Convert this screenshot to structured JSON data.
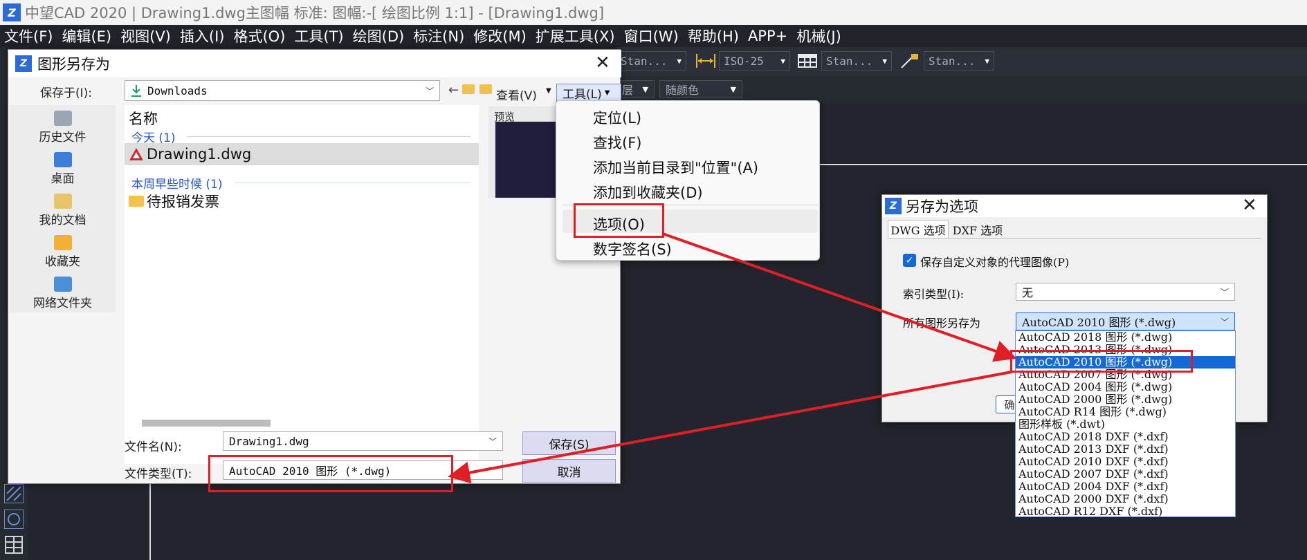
{
  "window": {
    "title": "中望CAD 2020 | Drawing1.dwg主图幅  标准: 图幅:-[ 绘图比例 1:1] - [Drawing1.dwg]",
    "logo": "Z"
  },
  "menubar": {
    "items": [
      "文件(F)",
      "编辑(E)",
      "视图(V)",
      "插入(I)",
      "格式(O)",
      "工具(T)",
      "绘图(D)",
      "标注(N)",
      "修改(M)",
      "扩展工具(X)",
      "窗口(W)",
      "帮助(H)",
      "APP+",
      "机械(J)"
    ]
  },
  "toolbar": {
    "text_style": "Stan...",
    "dim_style": "ISO-25",
    "table_style": "Stan...",
    "multileader_style": "Stan...",
    "layer": "层",
    "color": "随颜色"
  },
  "save_dialog": {
    "title": "图形另存为",
    "save_in_label": "保存于(I):",
    "save_in_value": "Downloads",
    "view_label": "查看(V)",
    "tools_label": "工具(L)",
    "places": [
      "历史文件",
      "桌面",
      "我的文档",
      "收藏夹",
      "网络文件夹"
    ],
    "column_name": "名称",
    "preview_label": "预览",
    "group_today": "今天 (1)",
    "file_drawing": "Drawing1.dwg",
    "group_earlier": "本周早些时候 (1)",
    "folder_invoice": "待报销发票",
    "filename_label": "文件名(N):",
    "filename_value": "Drawing1.dwg",
    "filetype_label": "文件类型(T):",
    "filetype_value": "AutoCAD 2010 图形 (*.dwg)",
    "save_button": "保存(S)",
    "cancel_button": "取消"
  },
  "tools_menu": {
    "items": [
      "定位(L)",
      "查找(F)",
      "添加当前目录到\"位置\"(A)",
      "添加到收藏夹(D)",
      "选项(O)",
      "数字签名(S)"
    ]
  },
  "options_dialog": {
    "title": "另存为选项",
    "tab_dwg": "DWG 选项",
    "tab_dxf": "DXF 选项",
    "proxy_checkbox": "保存自定义对象的代理图像(P)",
    "proxy_checked": true,
    "index_label": "索引类型(I):",
    "index_value": "无",
    "saveas_label": "所有图形另存为",
    "saveas_value": "AutoCAD 2010 图形 (*.dwg)",
    "button_fragment": "确",
    "formats": [
      "AutoCAD 2018 图形 (*.dwg)",
      "AutoCAD 2013 图形 (*.dwg)",
      "AutoCAD 2010 图形 (*.dwg)",
      "AutoCAD 2007 图形 (*.dwg)",
      "AutoCAD 2004 图形 (*.dwg)",
      "AutoCAD 2000 图形 (*.dwg)",
      "AutoCAD R14 图形 (*.dwg)",
      "图形样板 (*.dwt)",
      "AutoCAD 2018 DXF (*.dxf)",
      "AutoCAD 2013 DXF (*.dxf)",
      "AutoCAD 2010 DXF (*.dxf)",
      "AutoCAD 2007 DXF (*.dxf)",
      "AutoCAD 2004 DXF (*.dxf)",
      "AutoCAD 2000 DXF (*.dxf)",
      "AutoCAD R12 DXF (*.dxf)"
    ]
  },
  "colors": {
    "accent": "#1469d8",
    "highlight_red": "#e01e26",
    "app_background": "#22252d"
  }
}
